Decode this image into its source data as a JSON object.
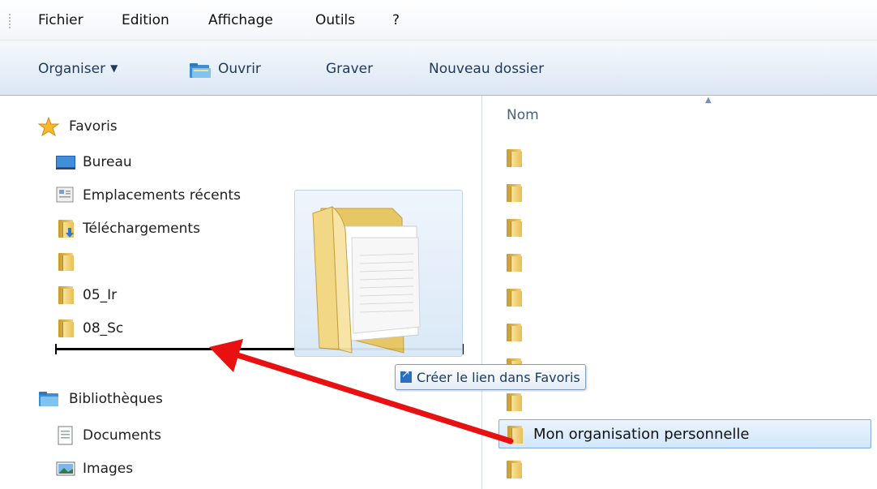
{
  "menu": [
    "Fichier",
    "Edition",
    "Affichage",
    "Outils",
    "?"
  ],
  "toolbar": {
    "organise": "Organiser",
    "open": "Ouvrir",
    "burn": "Graver",
    "new_folder": "Nouveau dossier"
  },
  "nav": {
    "favorites_header": "Favoris",
    "favorites": [
      "Bureau",
      "Emplacements récents",
      "Téléchargements",
      "",
      "05_Ir",
      "08_Sс"
    ],
    "libraries_header": "Bibliothèques",
    "libraries": [
      "Documents",
      "Images"
    ]
  },
  "content": {
    "column_name": "Nom",
    "files": [
      "",
      "",
      "",
      "",
      "",
      "",
      "",
      "",
      "Mon organisation personnelle",
      ""
    ],
    "selected_index": 8
  },
  "drag": {
    "tooltip": "Créer le lien dans Favoris"
  },
  "colors": {
    "toolbar_text": "#1e395b",
    "annotation_arrow": "#e81010",
    "selection": "#d2e6fb"
  }
}
